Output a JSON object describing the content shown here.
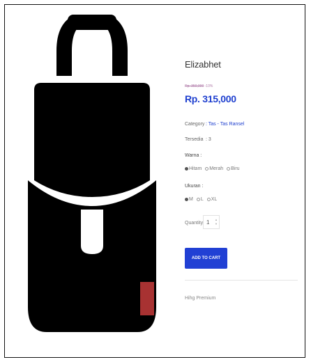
{
  "product": {
    "name": "Elizabhet",
    "old_price": "Rp. 350,000",
    "discount": "-10%",
    "price": "Rp. 315,000",
    "category_label": "Category",
    "category_value": ": Tas - Tas Ransel",
    "stock_label": "Tersedia",
    "stock_value": ": 3",
    "color_title": "Warna :",
    "colors": [
      "Hitam",
      "Merah",
      "Biru"
    ],
    "selected_color": "Hitam",
    "size_title": "Ukuran :",
    "sizes": [
      "M",
      "L",
      "XL"
    ],
    "selected_size": "M",
    "quantity_label": "Quantity",
    "quantity_value": "1",
    "add_to_cart": "ADD TO CART",
    "description": "Hihg Premium"
  },
  "colors_ui": {
    "accent": "#2140d4",
    "price": "#1e3fcf",
    "image_fill": "#000000",
    "image_tag": "#a83232"
  }
}
